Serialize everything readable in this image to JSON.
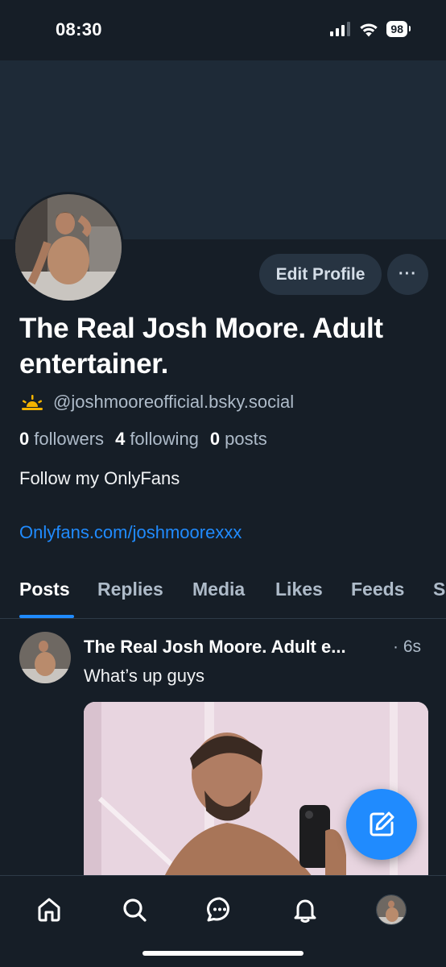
{
  "status_bar": {
    "time": "08:30",
    "battery": "98"
  },
  "profile": {
    "display_name": "The Real Josh Moore. Adult entertainer.",
    "handle": "@joshmooreofficial.bsky.social",
    "edit_button": "Edit Profile",
    "more_button": "···",
    "stats": {
      "followers_count": "0",
      "followers_label": "followers",
      "following_count": "4",
      "following_label": "following",
      "posts_count": "0",
      "posts_label": "posts"
    },
    "bio": "Follow my OnlyFans",
    "link": "Onlyfans.com/joshmoorexxx"
  },
  "tabs": [
    {
      "label": "Posts",
      "active": true
    },
    {
      "label": "Replies"
    },
    {
      "label": "Media"
    },
    {
      "label": "Likes"
    },
    {
      "label": "Feeds"
    },
    {
      "label": "S"
    }
  ],
  "post": {
    "author": "The Real Josh Moore. Adult e...",
    "time": "· 6s",
    "text": "What’s up guys"
  },
  "bottom_nav": [
    {
      "icon": "home-icon"
    },
    {
      "icon": "search-icon"
    },
    {
      "icon": "chat-icon"
    },
    {
      "icon": "bell-icon"
    },
    {
      "icon": "profile-avatar"
    }
  ],
  "colors": {
    "background": "#161e27",
    "banner": "#1e2a37",
    "accent": "#208bfe",
    "button_bg": "#273442",
    "muted_text": "#aebbc9"
  }
}
